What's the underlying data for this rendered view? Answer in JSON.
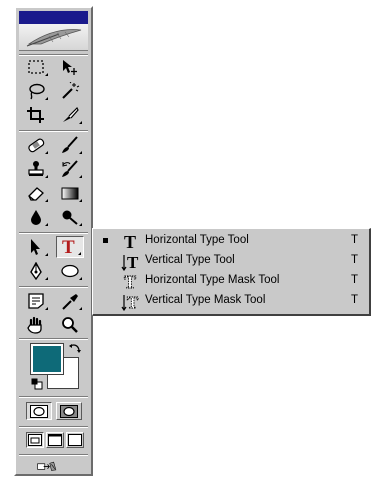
{
  "toolbox": {
    "foreground_color": "#0e6a78",
    "background_color": "#ffffff",
    "active_tool": "type-tool"
  },
  "flyout": {
    "items": [
      {
        "label": "Horizontal Type Tool",
        "shortcut": "T",
        "selected": true,
        "icon": "horizontal-type-icon"
      },
      {
        "label": "Vertical Type Tool",
        "shortcut": "T",
        "selected": false,
        "icon": "vertical-type-icon"
      },
      {
        "label": "Horizontal Type Mask Tool",
        "shortcut": "T",
        "selected": false,
        "icon": "horizontal-type-mask-icon"
      },
      {
        "label": "Vertical Type Mask Tool",
        "shortcut": "T",
        "selected": false,
        "icon": "vertical-type-mask-icon"
      }
    ]
  }
}
